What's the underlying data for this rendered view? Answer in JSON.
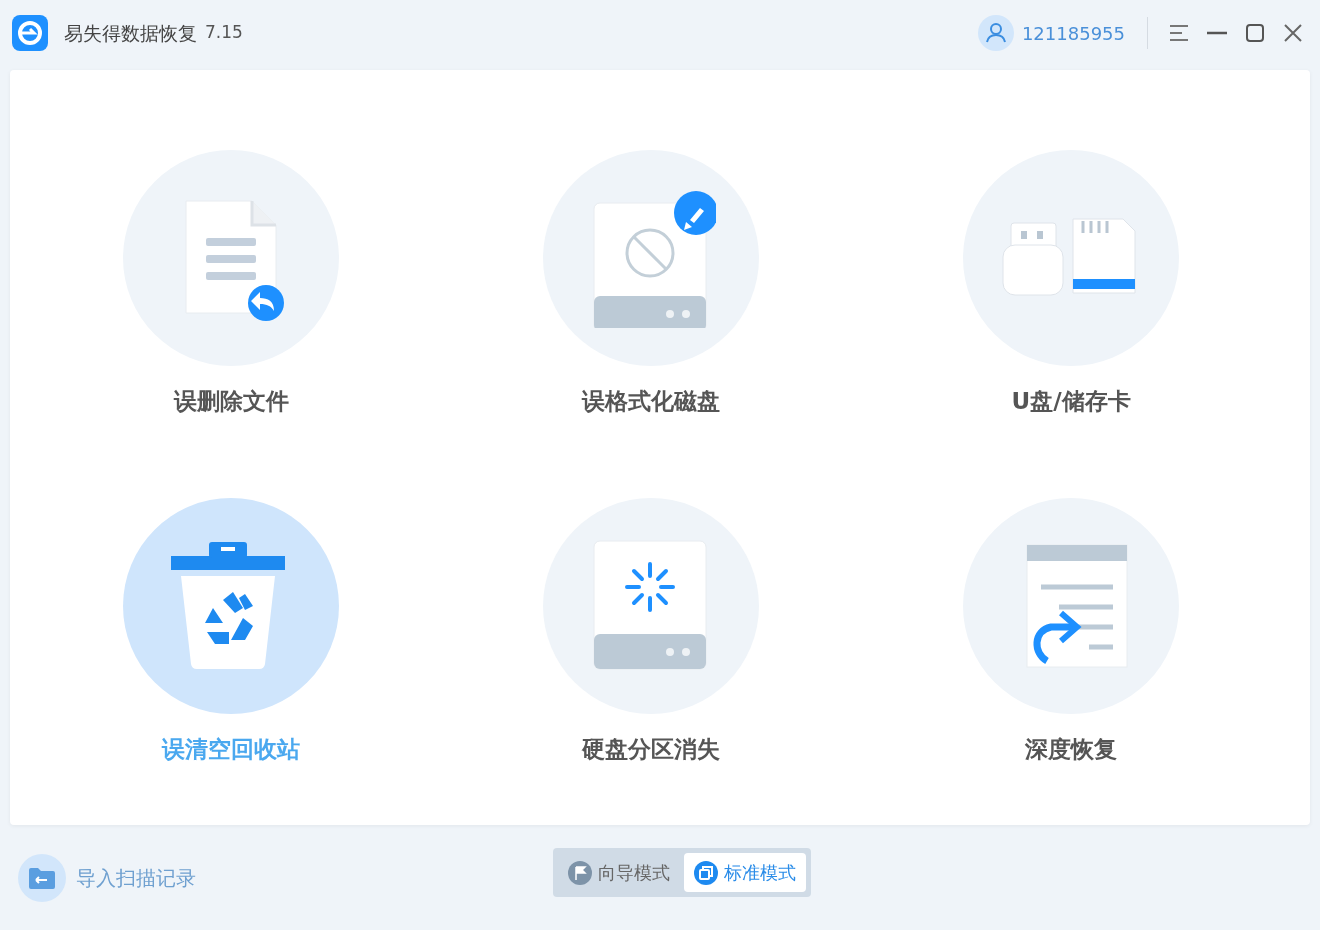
{
  "app": {
    "title": "易失得数据恢复",
    "version": "7.15"
  },
  "user": {
    "id": "121185955"
  },
  "tiles": [
    {
      "label": "误删除文件",
      "kind": "file",
      "selected": false
    },
    {
      "label": "误格式化磁盘",
      "kind": "format",
      "selected": false
    },
    {
      "label": "U盘/储存卡",
      "kind": "usb",
      "selected": false
    },
    {
      "label": "误清空回收站",
      "kind": "recycle",
      "selected": true
    },
    {
      "label": "硬盘分区消失",
      "kind": "partition",
      "selected": false
    },
    {
      "label": "深度恢复",
      "kind": "deep",
      "selected": false
    }
  ],
  "import_button": {
    "label": "导入扫描记录"
  },
  "modes": [
    {
      "label": "向导模式",
      "kind": "guide",
      "selected": false
    },
    {
      "label": "标准模式",
      "kind": "standard",
      "selected": true
    }
  ]
}
